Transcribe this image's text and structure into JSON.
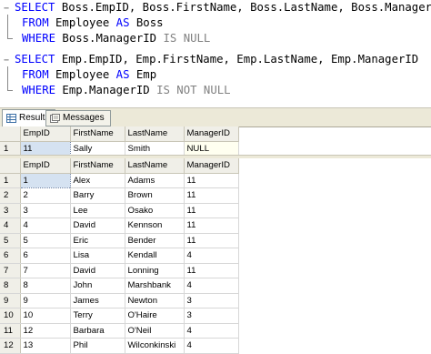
{
  "query": {
    "lines": [
      {
        "kw1": "SELECT",
        "rest1": " Boss.EmpID, Boss.FirstName, Boss.LastName, Boss.ManagerID"
      },
      {
        "kw1": "FROM",
        "rest1": " Employee ",
        "kw2": "AS",
        "rest2": " Boss"
      },
      {
        "kw1": "WHERE",
        "rest1": " Boss.ManagerID ",
        "gr1": "IS NULL"
      },
      {
        "kw1": "SELECT",
        "rest1": " Emp.EmpID, Emp.FirstName, Emp.LastName, Emp.ManagerID"
      },
      {
        "kw1": "FROM",
        "rest1": " Employee ",
        "kw2": "AS",
        "rest2": " Emp"
      },
      {
        "kw1": "WHERE",
        "rest1": " Emp.ManagerID ",
        "gr1": "IS NOT NULL"
      }
    ],
    "collapse_marker": "−"
  },
  "tabs": {
    "results": "Results",
    "messages": "Messages"
  },
  "colors": {
    "keyword": "#0000ff",
    "operator": "#808080"
  },
  "result1": {
    "columns": [
      "EmpID",
      "FirstName",
      "LastName",
      "ManagerID"
    ],
    "rows": [
      {
        "n": "1",
        "cells": [
          "11",
          "Sally",
          "Smith",
          "NULL"
        ]
      }
    ]
  },
  "result2": {
    "columns": [
      "EmpID",
      "FirstName",
      "LastName",
      "ManagerID"
    ],
    "rows": [
      {
        "n": "1",
        "cells": [
          "1",
          "Alex",
          "Adams",
          "11"
        ]
      },
      {
        "n": "2",
        "cells": [
          "2",
          "Barry",
          "Brown",
          "11"
        ]
      },
      {
        "n": "3",
        "cells": [
          "3",
          "Lee",
          "Osako",
          "11"
        ]
      },
      {
        "n": "4",
        "cells": [
          "4",
          "David",
          "Kennson",
          "11"
        ]
      },
      {
        "n": "5",
        "cells": [
          "5",
          "Eric",
          "Bender",
          "11"
        ]
      },
      {
        "n": "6",
        "cells": [
          "6",
          "Lisa",
          "Kendall",
          "4"
        ]
      },
      {
        "n": "7",
        "cells": [
          "7",
          "David",
          "Lonning",
          "11"
        ]
      },
      {
        "n": "8",
        "cells": [
          "8",
          "John",
          "Marshbank",
          "4"
        ]
      },
      {
        "n": "9",
        "cells": [
          "9",
          "James",
          "Newton",
          "3"
        ]
      },
      {
        "n": "10",
        "cells": [
          "10",
          "Terry",
          "O'Haire",
          "3"
        ]
      },
      {
        "n": "11",
        "cells": [
          "12",
          "Barbara",
          "O'Neil",
          "4"
        ]
      },
      {
        "n": "12",
        "cells": [
          "13",
          "Phil",
          "Wilconkinski",
          "4"
        ]
      }
    ]
  }
}
